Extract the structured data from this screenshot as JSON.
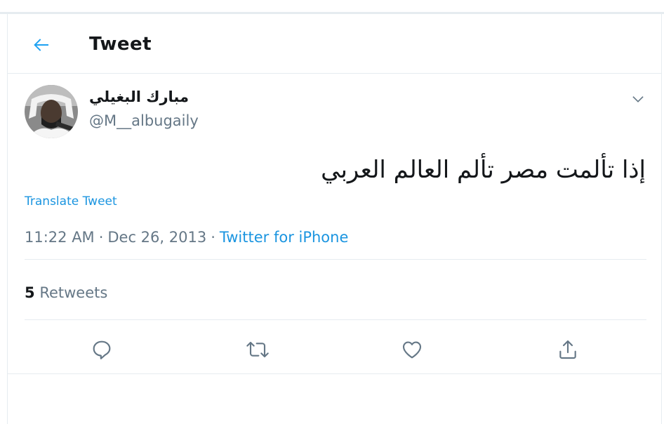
{
  "header": {
    "title": "Tweet",
    "back_icon": "arrow-left-icon",
    "accent_color": "#1da1f2"
  },
  "author": {
    "display_name": "مبارك البغيلي",
    "handle": "@M__albugaily",
    "avatar_icon": "avatar-photo"
  },
  "tweet": {
    "text": "إذا تألمت مصر تألم العالم العربي",
    "translate_label": "Translate Tweet",
    "time": "11:22 AM",
    "date": "Dec 26, 2013",
    "separator": "·",
    "source": "Twitter for iPhone"
  },
  "stats": {
    "retweet_count": "5",
    "retweet_label": "Retweets"
  },
  "actions": [
    {
      "name": "reply",
      "icon": "reply-icon"
    },
    {
      "name": "retweet",
      "icon": "retweet-icon"
    },
    {
      "name": "like",
      "icon": "heart-icon"
    },
    {
      "name": "share",
      "icon": "share-icon"
    }
  ],
  "colors": {
    "text_primary": "#14171a",
    "text_secondary": "#657786",
    "link": "#1b95e0",
    "border": "#e6ecf0"
  }
}
